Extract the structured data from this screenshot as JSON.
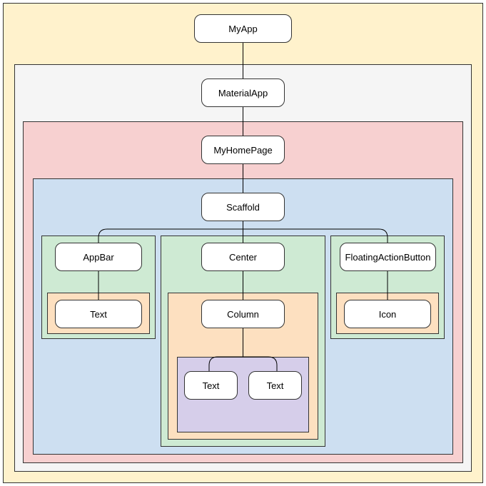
{
  "nodes": {
    "myapp": "MyApp",
    "materialapp": "MaterialApp",
    "myhomepage": "MyHomePage",
    "scaffold": "Scaffold",
    "appbar": "AppBar",
    "center": "Center",
    "fab": "FloatingActionButton",
    "text_appbar": "Text",
    "column": "Column",
    "icon": "Icon",
    "text_col1": "Text",
    "text_col2": "Text"
  },
  "colors": {
    "yellow": "#fff2cc",
    "gray": "#f5f5f5",
    "pink": "#f7d0d0",
    "blue": "#cddff1",
    "green": "#ceead3",
    "orange": "#fde0c0",
    "purple": "#d6ceea"
  }
}
